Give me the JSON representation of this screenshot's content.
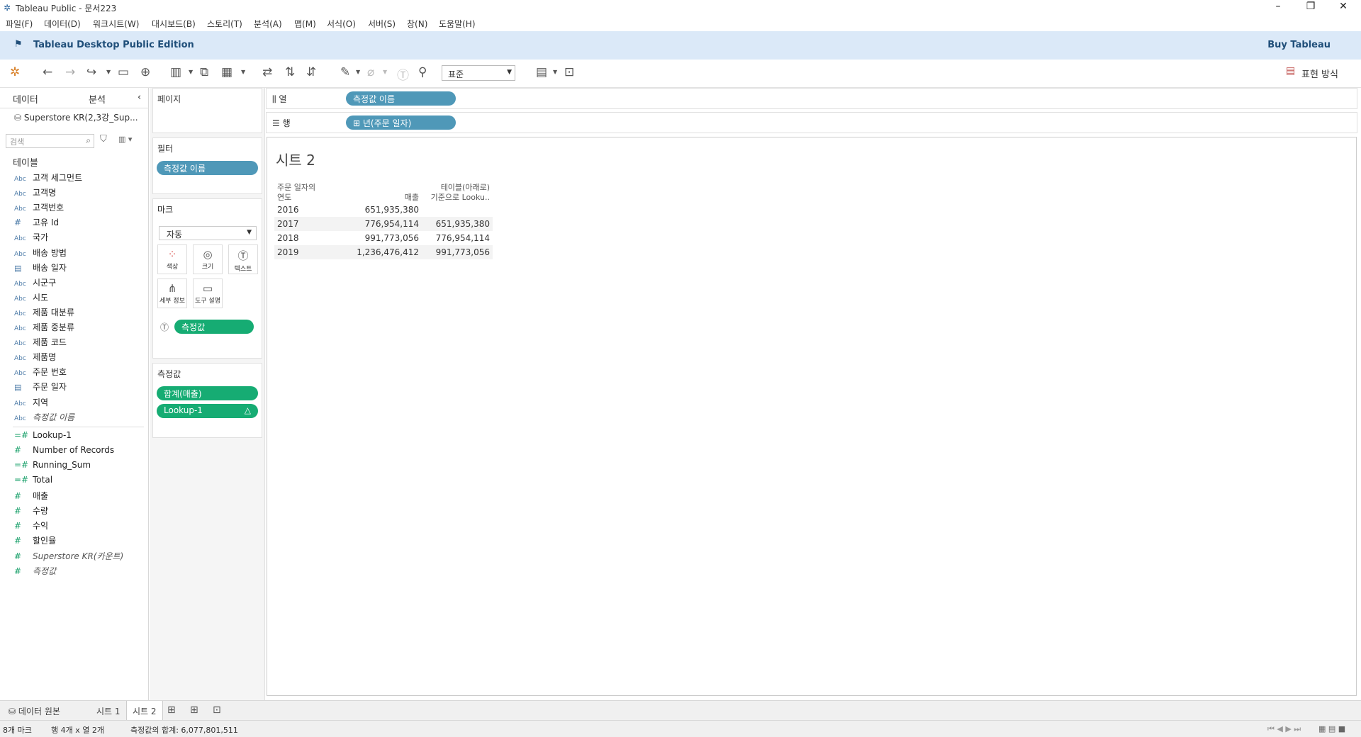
{
  "window": {
    "title": "Tableau Public - 문서223"
  },
  "menu": [
    "파일(F)",
    "데이터(D)",
    "워크시트(W)",
    "대시보드(B)",
    "스토리(T)",
    "분석(A)",
    "맵(M)",
    "서식(O)",
    "서버(S)",
    "창(N)",
    "도움말(H)"
  ],
  "promo": {
    "edition": "Tableau Desktop Public Edition",
    "buy": "Buy Tableau"
  },
  "toolbar": {
    "format_select": "표준",
    "show_me": "표현 방식"
  },
  "data_pane": {
    "tabs": [
      "데이터",
      "분석"
    ],
    "datasource": "Superstore KR(2,3강_Sup...",
    "search_placeholder": "검색",
    "tables_header": "테이블",
    "dimensions": [
      {
        "type": "Abc",
        "name": "고객 세그먼트"
      },
      {
        "type": "Abc",
        "name": "고객명"
      },
      {
        "type": "Abc",
        "name": "고객번호"
      },
      {
        "type": "#",
        "name": "고유 Id"
      },
      {
        "type": "Abc",
        "name": "국가"
      },
      {
        "type": "Abc",
        "name": "배송 방법"
      },
      {
        "type": "date",
        "name": "배송 일자"
      },
      {
        "type": "Abc",
        "name": "시군구"
      },
      {
        "type": "Abc",
        "name": "시도"
      },
      {
        "type": "Abc",
        "name": "제품 대분류"
      },
      {
        "type": "Abc",
        "name": "제품 중분류"
      },
      {
        "type": "Abc",
        "name": "제품 코드"
      },
      {
        "type": "Abc",
        "name": "제품명"
      },
      {
        "type": "Abc",
        "name": "주문 번호"
      },
      {
        "type": "date",
        "name": "주문 일자"
      },
      {
        "type": "Abc",
        "name": "지역"
      },
      {
        "type": "Abc",
        "name": "측정값 이름",
        "italic": true
      }
    ],
    "measures": [
      {
        "type": "=#",
        "name": "Lookup-1"
      },
      {
        "type": "#",
        "name": "Number of Records"
      },
      {
        "type": "=#",
        "name": "Running_Sum"
      },
      {
        "type": "=#",
        "name": "Total"
      },
      {
        "type": "#",
        "name": "매출"
      },
      {
        "type": "#",
        "name": "수량"
      },
      {
        "type": "#",
        "name": "수익"
      },
      {
        "type": "#",
        "name": "할인율"
      },
      {
        "type": "#",
        "name": "Superstore KR(카운트)",
        "italic": true
      },
      {
        "type": "#",
        "name": "측정값",
        "italic": true
      }
    ]
  },
  "cards": {
    "pages": "페이지",
    "filters": {
      "title": "필터",
      "pill": "측정값 이름"
    },
    "marks": {
      "title": "마크",
      "type": "자동",
      "buttons": [
        "색상",
        "크기",
        "텍스트",
        "세부 정보",
        "도구 설명"
      ],
      "text_pill": "측정값"
    },
    "measure_values": {
      "title": "측정값",
      "pills": [
        "합계(매출)",
        "Lookup-1"
      ]
    }
  },
  "shelves": {
    "columns": {
      "label": "열",
      "pill": "측정값 이름"
    },
    "rows": {
      "label": "행",
      "pill": "년(주문 일자)"
    }
  },
  "view": {
    "title": "시트 2",
    "headers": {
      "row_header": [
        "주문 일자의",
        "연도"
      ],
      "col1": "매출",
      "col2": [
        "테이블(아래로)",
        "기준으로 Looku.."
      ]
    },
    "rows": [
      {
        "year": "2016",
        "sales": "651,935,380",
        "lookup": ""
      },
      {
        "year": "2017",
        "sales": "776,954,114",
        "lookup": "651,935,380"
      },
      {
        "year": "2018",
        "sales": "991,773,056",
        "lookup": "776,954,114"
      },
      {
        "year": "2019",
        "sales": "1,236,476,412",
        "lookup": "991,773,056"
      }
    ]
  },
  "sheet_tabs": [
    "데이터 원본",
    "시트 1",
    "시트 2"
  ],
  "status": {
    "marks": "8개 마크",
    "rowscols": "행 4개 x 열 2개",
    "sum": "측정값의 합계: 6,077,801,511"
  }
}
